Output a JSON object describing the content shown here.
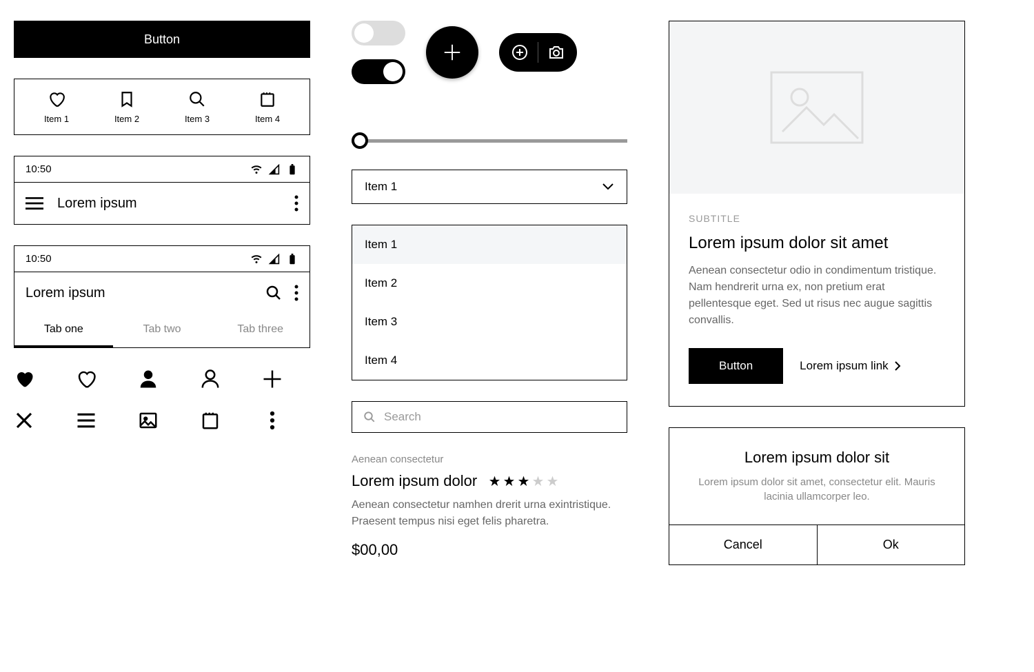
{
  "button_primary": "Button",
  "tabbar": [
    {
      "label": "Item 1",
      "icon": "heart-icon"
    },
    {
      "label": "Item 2",
      "icon": "bookmark-icon"
    },
    {
      "label": "Item 3",
      "icon": "search-icon"
    },
    {
      "label": "Item 4",
      "icon": "calendar-icon"
    }
  ],
  "status_time": "10:50",
  "header1_title": "Lorem ipsum",
  "header2_title": "Lorem ipsum",
  "tabs": [
    "Tab one",
    "Tab two",
    "Tab three"
  ],
  "select_value": "Item 1",
  "list_items": [
    "Item 1",
    "Item 2",
    "Item 3",
    "Item 4"
  ],
  "search_placeholder": "Search",
  "product": {
    "subtitle": "Aenean consectetur",
    "title": "Lorem ipsum dolor",
    "rating": 3,
    "rating_max": 5,
    "description": "Aenean consectetur namhen drerit urna exintristique. Praesent tempus nisi eget felis pharetra.",
    "price": "$00,00"
  },
  "card": {
    "subtitle": "SUBTITLE",
    "title": "Lorem ipsum dolor sit amet",
    "text": "Aenean consectetur odio in condimentum tristique. Nam hendrerit urna ex, non pretium erat pellentesque eget. Sed ut risus nec augue sagittis convallis.",
    "button": "Button",
    "link": "Lorem ipsum link"
  },
  "dialog": {
    "title": "Lorem ipsum dolor sit",
    "text": "Lorem ipsum dolor sit amet, consectetur elit. Mauris lacinia ullamcorper leo.",
    "cancel": "Cancel",
    "ok": "Ok"
  }
}
